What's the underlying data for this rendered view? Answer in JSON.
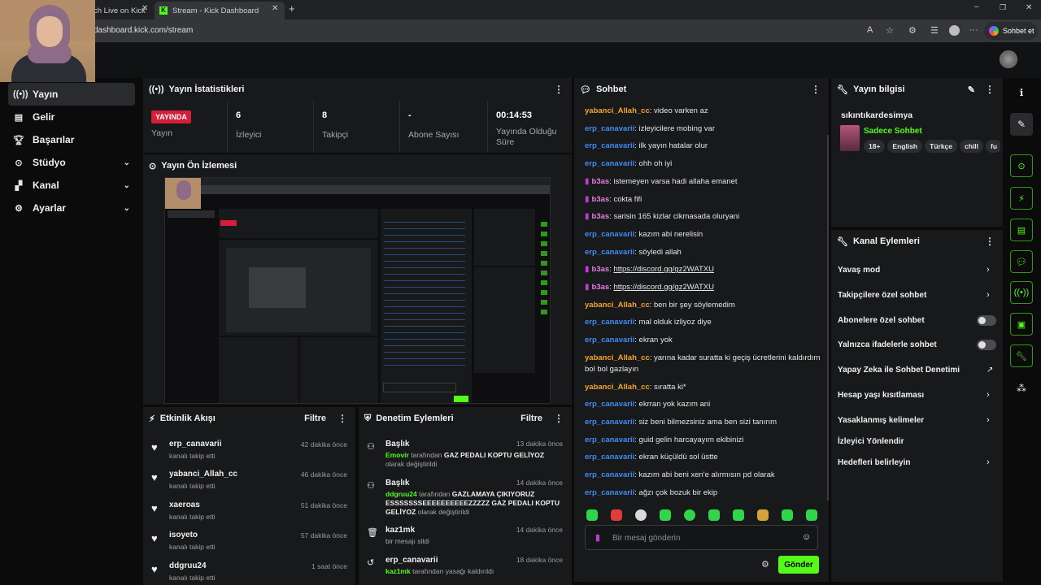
{
  "browser": {
    "tabs": [
      {
        "label": "ch Live on Kick"
      },
      {
        "label": "Stream - Kick Dashboard"
      }
    ],
    "url": "dashboard.kick.com/stream",
    "profile_button": "Sohbet et"
  },
  "sidebar": {
    "items": [
      {
        "label": "Yayın",
        "icon": "broadcast-icon"
      },
      {
        "label": "Gelir",
        "icon": "revenue-icon"
      },
      {
        "label": "Başarılar",
        "icon": "trophy-icon"
      },
      {
        "label": "Stüdyo",
        "icon": "studio-icon"
      },
      {
        "label": "Kanal",
        "icon": "channel-icon"
      },
      {
        "label": "Ayarlar",
        "icon": "gear-icon"
      }
    ]
  },
  "stats": {
    "title": "Yayın İstatistikleri",
    "live_badge": "YAYINDA",
    "items": [
      {
        "value": "",
        "label": "Yayın"
      },
      {
        "value": "6",
        "label": "İzleyici"
      },
      {
        "value": "8",
        "label": "Takipçi"
      },
      {
        "value": "-",
        "label": "Abone Sayısı"
      },
      {
        "value": "00:14:53",
        "label": "Yayında Olduğu Süre"
      }
    ]
  },
  "preview": {
    "title": "Yayın Ön İzlemesi"
  },
  "activity": {
    "title": "Etkinlik Akışı",
    "filter": "Filtre",
    "items": [
      {
        "name": "erp_canavarii",
        "sub": "kanalı takip etti",
        "time": "42 dakika önce"
      },
      {
        "name": "yabanci_Allah_cc",
        "sub": "kanalı takip etti",
        "time": "46 dakika önce"
      },
      {
        "name": "xaeroas",
        "sub": "kanalı takip etti",
        "time": "51 dakika önce"
      },
      {
        "name": "isoyeto",
        "sub": "kanalı takip etti",
        "time": "57 dakika önce"
      },
      {
        "name": "ddgruu24",
        "sub": "kanalı takip etti",
        "time": "1 saat önce"
      }
    ]
  },
  "moderation": {
    "title": "Denetim Eylemleri",
    "filter": "Filtre",
    "items": [
      {
        "title": "Başlık",
        "time": "13 dakika önce",
        "actor": "Emovir",
        "mid": " tarafından ",
        "target": "GAZ PEDALI KOPTU GELİYOZ",
        "tail": " olarak değiştirildi"
      },
      {
        "title": "Başlık",
        "time": "14 dakika önce",
        "actor": "ddgruu24",
        "mid": " tarafından ",
        "target": "GAZLAMAYA ÇIKIYORUZ ESSSSSSSEEEEEEEEEEZZZZZ GAZ PEDALI KOPTU GELİYOZ",
        "tail": " olarak değiştirildi"
      },
      {
        "title": "kaz1mk",
        "time": "14 dakika önce",
        "line": "bir mesajı sildi"
      },
      {
        "title": "erp_canavarii",
        "time": "18 dakika önce",
        "actor": "kaz1mk",
        "mid": " tarafından yasağı kaldırıldı"
      }
    ]
  },
  "chat": {
    "title": "Sohbet",
    "messages": [
      {
        "user": "yabanci_Allah_cc",
        "color": "orange",
        "text": ": video varken az"
      },
      {
        "user": "erp_canavarii",
        "color": "blue",
        "text": ": izleyicilere mobing var"
      },
      {
        "user": "erp_canavarii",
        "color": "blue",
        "text": ": ilk yayın hatalar olur"
      },
      {
        "user": "erp_canavarii",
        "color": "blue",
        "text": ": ohh oh iyi"
      },
      {
        "user": "b3as",
        "color": "pink",
        "text": ": istemeyen varsa hadi allaha emanet"
      },
      {
        "user": "b3as",
        "color": "pink",
        "text": ": cokta fifi"
      },
      {
        "user": "b3as",
        "color": "pink",
        "text": ": sarisin 165 kizlar cikmasada oluryani"
      },
      {
        "user": "erp_canavarii",
        "color": "blue",
        "text": ": kazım abi nerelisin"
      },
      {
        "user": "erp_canavarii",
        "color": "blue",
        "text": ": söyledi allah"
      },
      {
        "user": "b3as",
        "color": "pink",
        "link": "https://discord.gg/gz2WATXU"
      },
      {
        "user": "b3as",
        "color": "pink",
        "link": "https://discord.gg/gz2WATXU"
      },
      {
        "user": "yabanci_Allah_cc",
        "color": "orange",
        "text": ": ben bir şey söylemedim"
      },
      {
        "user": "erp_canavarii",
        "color": "blue",
        "text": ": mal olduk izliyoz diye"
      },
      {
        "user": "erp_canavarii",
        "color": "blue",
        "text": ": ekran yok"
      },
      {
        "user": "yabanci_Allah_cc",
        "color": "orange",
        "text": ": yarına kadar suratta ki geçiş ücretlerini kaldırdım bol bol gazlayın"
      },
      {
        "user": "yabanci_Allah_cc",
        "color": "orange",
        "text": ": sıratta ki*"
      },
      {
        "user": "erp_canavarii",
        "color": "blue",
        "text": ": ekrran yok kazım ani"
      },
      {
        "user": "erp_canavarii",
        "color": "blue",
        "text": ": siz beni bilmezsiniz ama ben sizi tanırım"
      },
      {
        "user": "erp_canavarii",
        "color": "blue",
        "text": ": guid gelin harcayayım ekibinizi"
      },
      {
        "user": "erp_canavarii",
        "color": "blue",
        "text": ": ekran küçüldü sol üstte"
      },
      {
        "user": "erp_canavarii",
        "color": "blue",
        "text": ": kazım abi beni xen'e alırmısın pd olarak"
      },
      {
        "user": "erp_canavarii",
        "color": "blue",
        "text": ": ağzı çok bozuk bir ekip"
      }
    ],
    "input_placeholder": "Bir mesaj gönderin",
    "send": "Gönder"
  },
  "stream_info": {
    "title": "Yayın bilgisi",
    "stream_title": "sıkıntıkardesimya",
    "category": "Sadece Sohbet",
    "tags": [
      "18+",
      "English",
      "Türkçe",
      "chill",
      "fu"
    ]
  },
  "channel_actions": {
    "title": "Kanal Eylemleri",
    "items": [
      {
        "label": "Yavaş mod",
        "control": "chevron"
      },
      {
        "label": "Takipçilere özel sohbet",
        "control": "chevron"
      },
      {
        "label": "Abonelere özel sohbet",
        "control": "toggle"
      },
      {
        "label": "Yalnızca ifadelerle sohbet",
        "control": "toggle"
      },
      {
        "label": "Yapay Zeka ile Sohbet Denetimi",
        "control": "external"
      },
      {
        "label": "Hesap yaşı kısıtlaması",
        "control": "chevron"
      },
      {
        "label": "Yasaklanmış kelimeler",
        "control": "chevron"
      },
      {
        "label": "İzleyici Yönlendir",
        "control": "none"
      },
      {
        "label": "Hedefleri belirleyin",
        "control": "chevron"
      }
    ]
  },
  "colors": {
    "accent": "#53fc18",
    "live": "#d51f3a",
    "user_orange": "#f5a524",
    "user_blue": "#3f8cf3",
    "user_pink": "#ea7ce6"
  }
}
